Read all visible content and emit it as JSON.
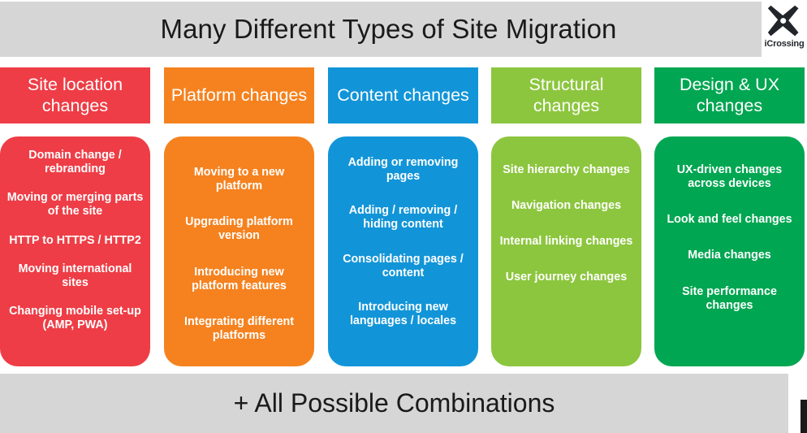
{
  "header": {
    "title": "Many Different Types of Site Migration",
    "background_color": "#d6d6d6",
    "text_color": "#1a1a1a"
  },
  "logo": {
    "name": "iCrossing",
    "label": "iCrossing",
    "mark_color": "#22262b",
    "mark_shape": "x-mark"
  },
  "footer": {
    "title": "+ All Possible Combinations",
    "background_color": "#d6d6d6",
    "text_color": "#1a1a1a"
  },
  "columns": [
    {
      "id": "site-location-changes",
      "heading": "Site location changes",
      "color": "#ee3d46",
      "items": [
        "Domain change / rebranding",
        "Moving or merging parts of the site",
        "HTTP to HTTPS / HTTP2",
        "Moving international sites",
        "Changing mobile set-up (AMP, PWA)"
      ]
    },
    {
      "id": "platform-changes",
      "heading": "Platform changes",
      "color": "#f5821f",
      "items": [
        "Moving to a new platform",
        "Upgrading platform version",
        "Introducing new platform features",
        "Integrating different platforms"
      ]
    },
    {
      "id": "content-changes",
      "heading": "Content changes",
      "color": "#1295d8",
      "items": [
        "Adding or removing pages",
        "Adding  / removing / hiding content",
        "Consolidating pages / content",
        "Introducing new languages / locales"
      ]
    },
    {
      "id": "structural-changes",
      "heading": "Structural changes",
      "color": "#8cc63e",
      "items": [
        "Site hierarchy changes",
        "Navigation changes",
        "Internal linking changes",
        "User journey changes"
      ]
    },
    {
      "id": "design-ux-changes",
      "heading": "Design & UX changes",
      "color": "#00a651",
      "items": [
        "UX-driven changes across devices",
        "Look and feel changes",
        "Media changes",
        "Site performance changes"
      ]
    }
  ]
}
